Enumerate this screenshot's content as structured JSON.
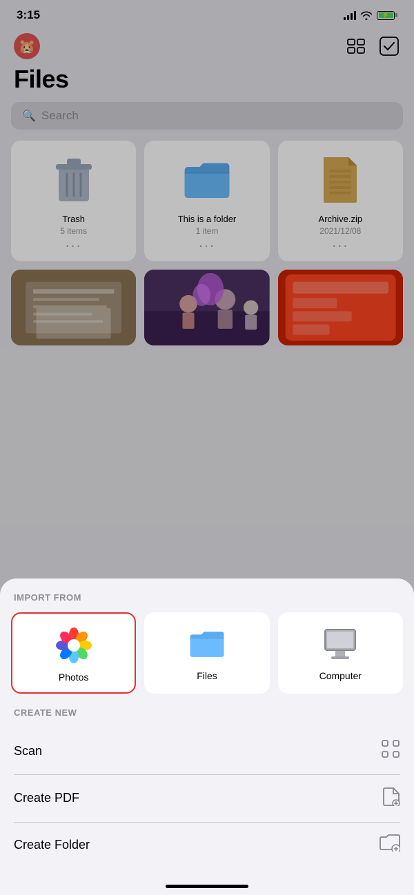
{
  "statusBar": {
    "time": "3:15",
    "signal": "signal-icon",
    "wifi": "wifi-icon",
    "battery": "battery-icon"
  },
  "header": {
    "logo": "🐹",
    "gridViewIcon": "grid-view-icon",
    "checkIcon": "check-icon"
  },
  "pageTitle": "Files",
  "search": {
    "placeholder": "Search"
  },
  "fileCards": [
    {
      "name": "Trash",
      "meta": "5 items",
      "type": "trash"
    },
    {
      "name": "This is a folder",
      "meta": "1 item",
      "type": "folder"
    },
    {
      "name": "Archive.zip",
      "meta": "2021/12/08",
      "type": "archive"
    }
  ],
  "photoThumbs": [
    {
      "type": "receipt"
    },
    {
      "type": "classroom"
    },
    {
      "type": "app"
    }
  ],
  "actionSheet": {
    "importLabel": "IMPORT FROM",
    "importItems": [
      {
        "label": "Photos",
        "type": "photos",
        "selected": true
      },
      {
        "label": "Files",
        "type": "files",
        "selected": false
      },
      {
        "label": "Computer",
        "type": "computer",
        "selected": false
      }
    ],
    "createLabel": "CREATE NEW",
    "createItems": [
      {
        "label": "Scan",
        "iconType": "scan-icon"
      },
      {
        "label": "Create PDF",
        "iconType": "pdf-icon"
      },
      {
        "label": "Create Folder",
        "iconType": "folder-plus-icon"
      }
    ]
  },
  "homeIndicator": true
}
